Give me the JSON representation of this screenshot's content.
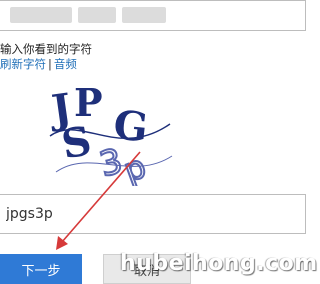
{
  "form": {
    "prompt": "输入你看到的字符",
    "refresh_link": "刷新字符",
    "separator": "|",
    "audio_link": "音频",
    "answer_value": "jpgs3p",
    "next_button": "下一步",
    "cancel_button": "取消"
  },
  "captcha": {
    "text": "JPGS3p",
    "colors": {
      "dark": "#1e2f7a",
      "light": "#5a67b0"
    }
  },
  "annotation": {
    "arrow_color": "#d63a3a"
  },
  "watermark": {
    "text": "hubeihong.com"
  }
}
